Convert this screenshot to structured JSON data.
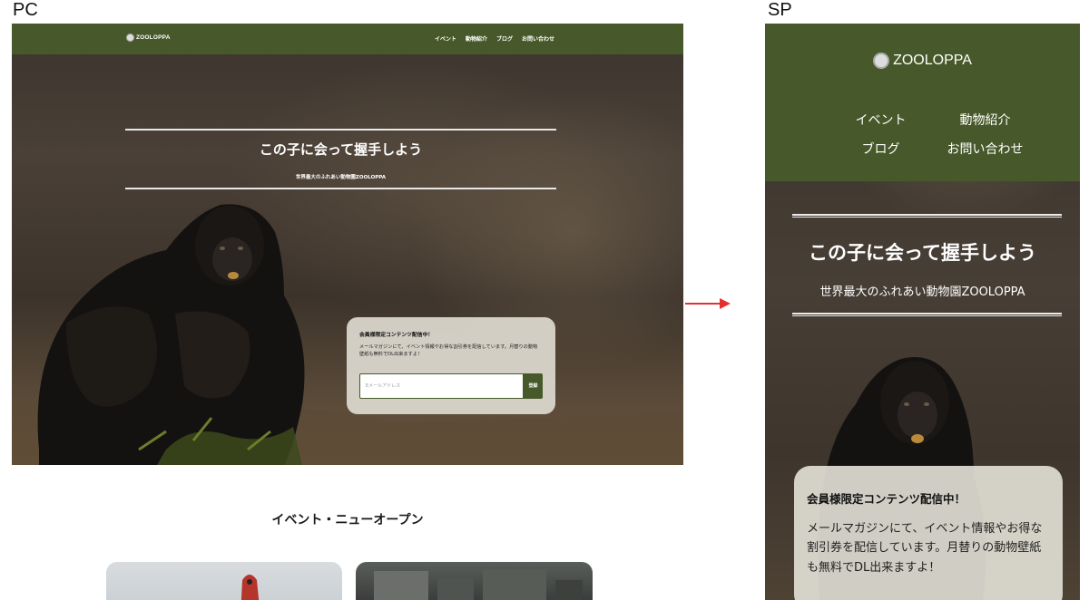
{
  "labels": {
    "pc": "PC",
    "sp": "SP"
  },
  "pc": {
    "brand": "ZOOLOPPA",
    "menu": [
      "イベント",
      "動物紹介",
      "ブログ",
      "お問い合わせ"
    ],
    "hero_title": "この子に会って握手しよう",
    "hero_subtitle": "世界最大のふれあい動物園ZOOLOPPA",
    "member_card": {
      "title": "会員様限定コンテンツ配信中！",
      "body": "メールマガジンにて、イベント情報やお得な割引券を配信しています。月替りの動物壁紙も無料でDL出来ますよ！",
      "email_placeholder": "Eメールアドレス",
      "submit_label": "登録"
    },
    "section_title": "イベント・ニューオープン"
  },
  "sp": {
    "brand": "ZOOLOPPA",
    "menu": [
      "イベント",
      "動物紹介",
      "ブログ",
      "お問い合わせ"
    ],
    "hero_title": "この子に会って握手しよう",
    "hero_subtitle": "世界最大のふれあい動物園ZOOLOPPA",
    "member_card": {
      "title": "会員様限定コンテンツ配信中！",
      "body": "メールマガジンにて、イベント情報やお得な割引券を配信しています。月替りの動物壁紙も無料でDL出来ますよ！"
    }
  },
  "colors": {
    "brand_green": "#47592a",
    "arrow": "#e53030"
  },
  "icons": {
    "logo": "panda-face-icon",
    "arrow": "arrow-right-icon"
  }
}
